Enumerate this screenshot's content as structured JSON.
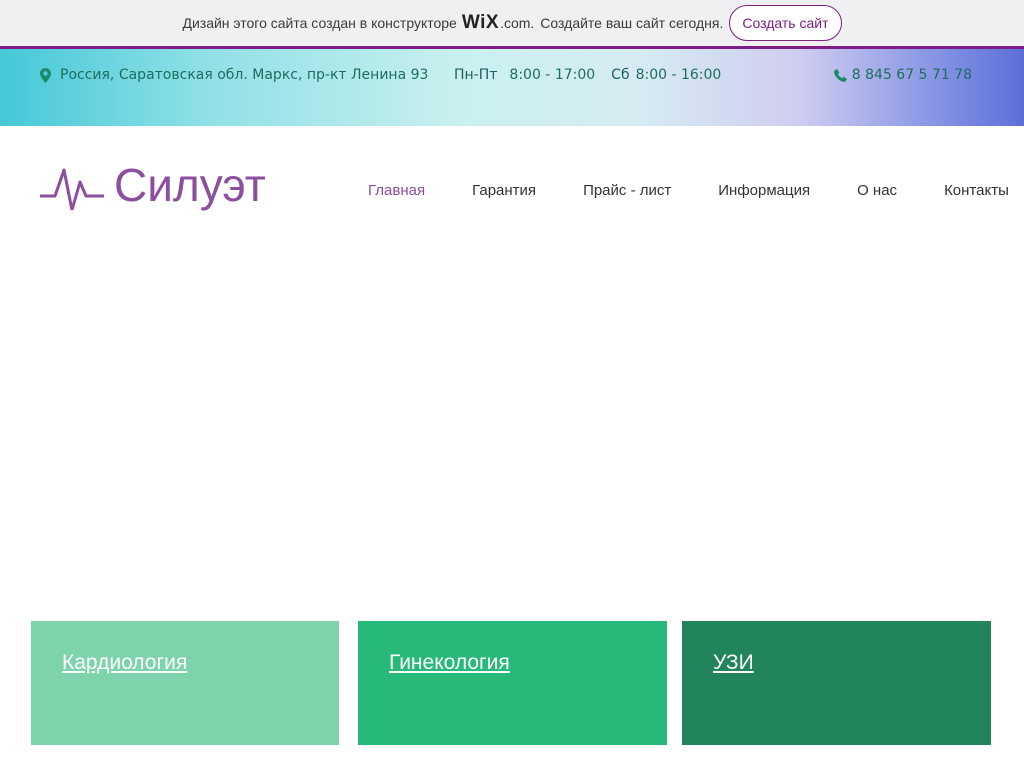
{
  "banner": {
    "text": "Дизайн этого сайта создан в конструкторе",
    "wix_logo": "WiX",
    "wix_domain": ".com.",
    "cta_text": "Создайте ваш сайт сегодня.",
    "button_label": "Создать сайт",
    "accent_color": "#7d1d85"
  },
  "contact": {
    "address": "Россия, Саратовская обл. Маркс, пр-кт Ленина 93",
    "weekday_label": "Пн-Пт",
    "weekday_hours": "8:00 - 17:00",
    "saturday_label": "Сб",
    "saturday_hours": "8:00 - 16:00",
    "phone": "8 845 67 5 71 78",
    "icons": [
      "map-pin-icon",
      "phone-icon"
    ]
  },
  "header": {
    "logo_text": "Силуэт",
    "logo_icon": "heartbeat-icon",
    "brand_color": "#8c4f9e"
  },
  "nav": {
    "items": [
      {
        "label": "Главная",
        "active": true
      },
      {
        "label": "Гарантия"
      },
      {
        "label": "Прайс - лист"
      },
      {
        "label": "Информация"
      },
      {
        "label": "О нас"
      },
      {
        "label": "Контакты"
      }
    ]
  },
  "services": [
    {
      "label": "Кардиология",
      "color": "#7dd3aa"
    },
    {
      "label": "Гинекология",
      "color": "#27b978"
    },
    {
      "label": "УЗИ",
      "color": "#21845a"
    }
  ]
}
